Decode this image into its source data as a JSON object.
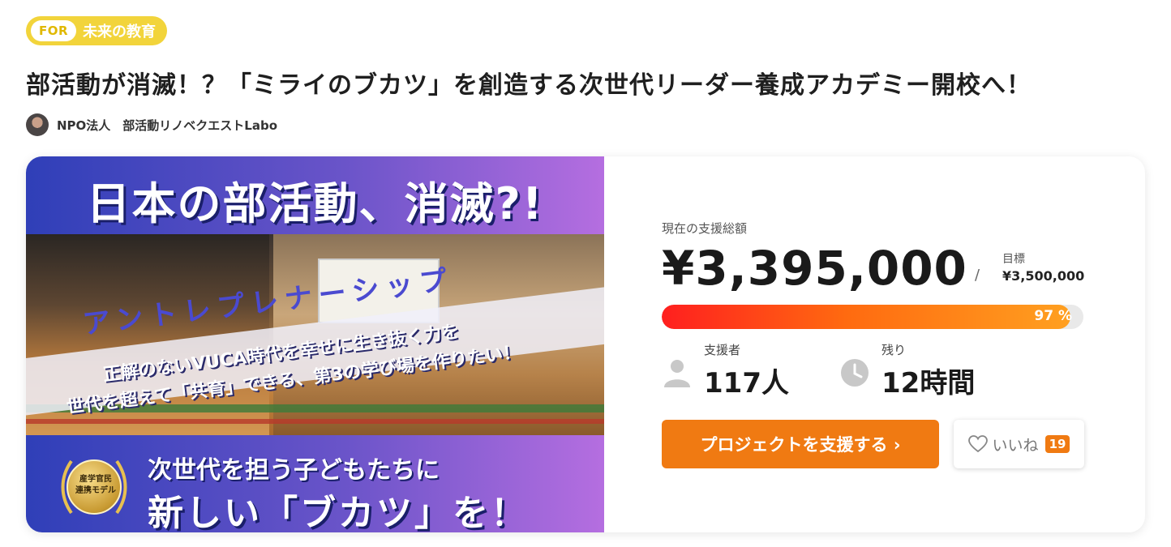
{
  "tag": {
    "prefix": "FOR",
    "label": "未来の教育"
  },
  "project": {
    "title": "部活動が消滅！？「ミライのブカツ」を創造する次世代リーダー養成アカデミー開校へ！",
    "owner": "NPO法人　部活動リノベクエストLabo"
  },
  "hero": {
    "headline": "日本の部活動、消滅?!",
    "banner": "アントレプレナーシップ",
    "sub_line1": "正解のないVUCA時代を幸せに生き抜く力を",
    "sub_line2": "世代を超えて「共育」できる、第3の学び場を作りたい！",
    "medal_line1": "産学官民",
    "medal_line2": "連携モデル",
    "bottom_line1": "次世代を担う子どもたちに",
    "bottom_line2": "新しい「ブカツ」を！"
  },
  "funding": {
    "total_label": "現在の支援総額",
    "total_amount": "¥3,395,000",
    "slash": "/",
    "goal_label": "目標",
    "goal_amount": "¥3,500,000",
    "progress_percent": 97,
    "progress_text": "97 %",
    "supporters_label": "支援者",
    "supporters_value": "117人",
    "remaining_label": "残り",
    "remaining_value": "12時間"
  },
  "actions": {
    "support_button": "プロジェクトを支援する ›",
    "like_label": "いいね",
    "like_count": "19"
  },
  "colors": {
    "accent": "#f07a12",
    "tag_bg": "#f2d43b",
    "progress_start": "#ff1f1f",
    "progress_end": "#ffa020"
  }
}
